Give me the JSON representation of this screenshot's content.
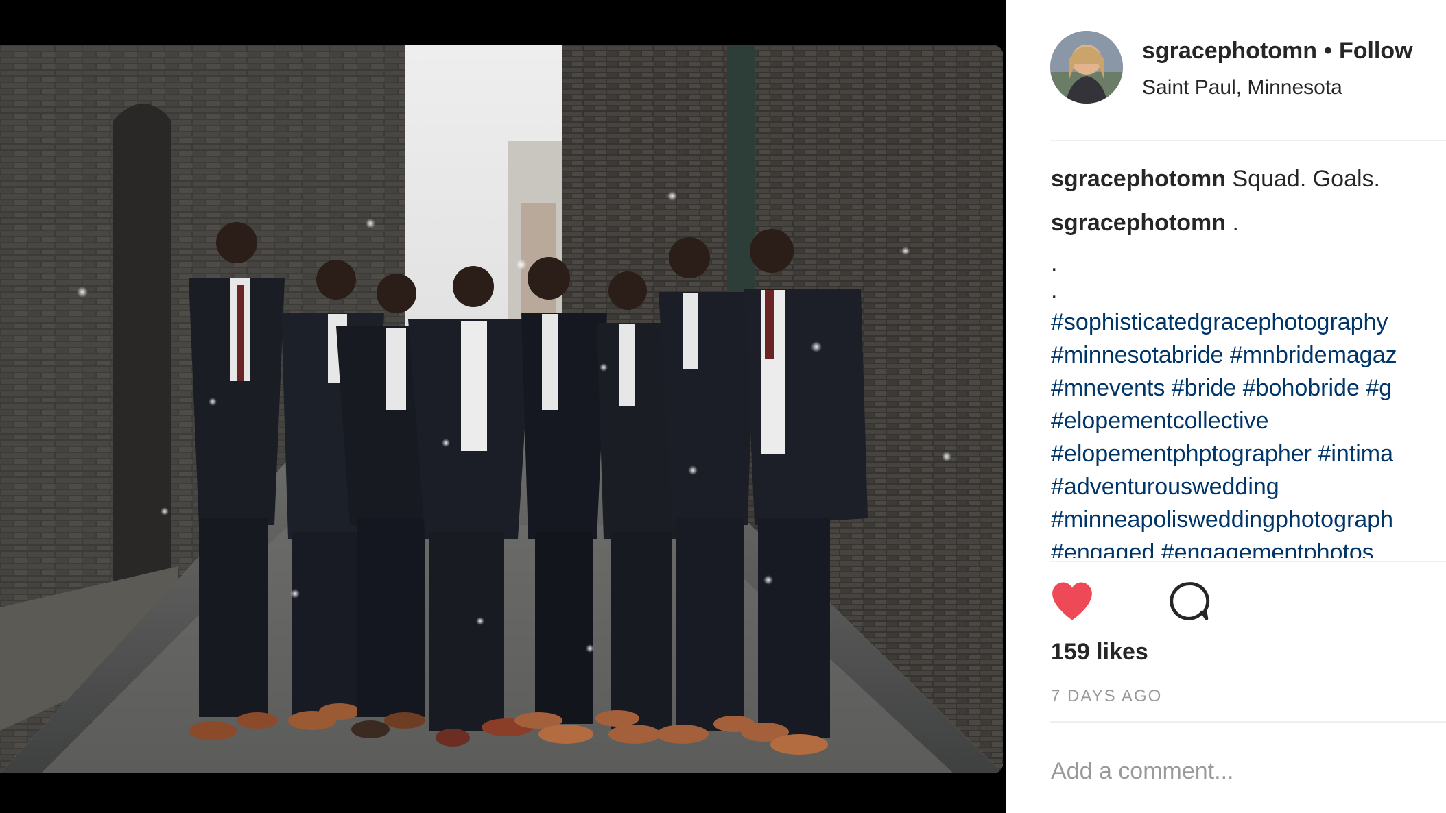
{
  "post": {
    "username": "sgracephotomn",
    "separator": "•",
    "follow_label": "Follow",
    "location": "Saint Paul, Minnesota",
    "caption": {
      "user": "sgracephotomn",
      "text": "Squad. Goals."
    },
    "comment": {
      "user": "sgracephotomn",
      "text": "."
    },
    "dot_lines": [
      ".",
      "."
    ],
    "hashtag_lines": [
      "#sophisticatedgracephotography",
      "#minnesotabride #mnbridemagaz",
      "#mnevents #bride #bohobride #g",
      "#elopementcollective",
      "#elopementphptographer #intima",
      "#adventurouswedding",
      "#minneapolisweddingphotograph",
      "#engaged #engagementphotos"
    ],
    "likes_label": "159 likes",
    "timestamp": "7 DAYS AGO",
    "comment_placeholder": "Add a comment...",
    "icons": {
      "like": "heart-icon",
      "comment": "comment-bubble-icon"
    },
    "colors": {
      "heart": "#ed4956",
      "hashtag": "#003569",
      "text": "#262626",
      "muted": "#999999"
    }
  }
}
